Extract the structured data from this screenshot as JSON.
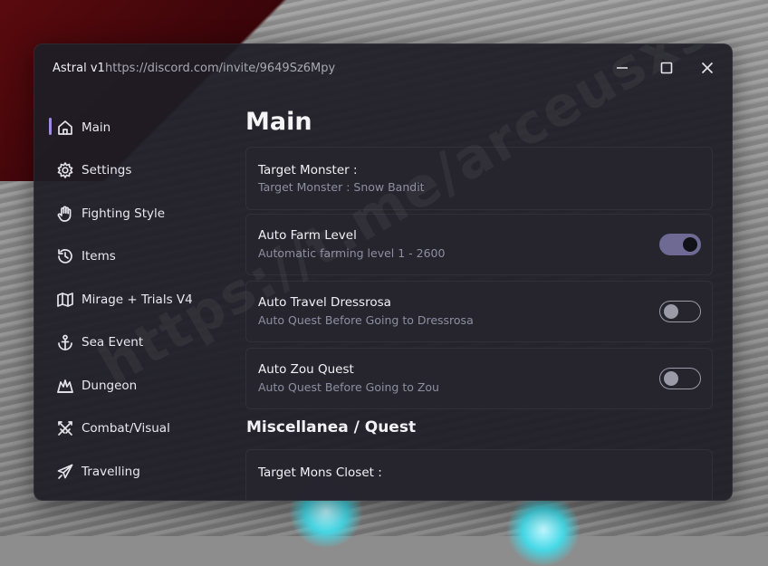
{
  "window": {
    "app_name": "Astral v1",
    "link": "https://discord.com/invite/9649Sz6Mpy"
  },
  "controls": {
    "minimize_icon": "minimize-icon",
    "maximize_icon": "maximize-icon",
    "close_icon": "close-icon"
  },
  "sidebar": {
    "items": [
      {
        "label": "Main",
        "icon": "home-icon",
        "active": true
      },
      {
        "label": "Settings",
        "icon": "gear-icon"
      },
      {
        "label": "Fighting Style",
        "icon": "hand-icon"
      },
      {
        "label": "Items",
        "icon": "history-icon"
      },
      {
        "label": "Mirage + Trials V4",
        "icon": "map-icon"
      },
      {
        "label": "Sea Event",
        "icon": "anchor-icon"
      },
      {
        "label": "Dungeon",
        "icon": "castle-icon"
      },
      {
        "label": "Combat/Visual",
        "icon": "swords-icon"
      },
      {
        "label": "Travelling",
        "icon": "plane-icon"
      }
    ]
  },
  "main": {
    "title": "Main",
    "target_monster": {
      "title": "Target Monster :",
      "subtitle": "Target Monster : Snow Bandit"
    },
    "toggles": [
      {
        "title": "Auto Farm Level",
        "subtitle": "Automatic farming level 1 - 2600",
        "enabled": true
      },
      {
        "title": "Auto Travel Dressrosa",
        "subtitle": "Auto Quest Before Going to Dressrosa",
        "enabled": false
      },
      {
        "title": "Auto Zou Quest",
        "subtitle": "Auto Quest Before Going to Zou",
        "enabled": false
      }
    ],
    "section_misc": "Miscellanea / Quest",
    "target_closet": {
      "title": "Target Mons Closet :"
    }
  },
  "overlay": {
    "watermark": "https://t.me/arceusxscripts"
  },
  "colors": {
    "window_bg": "#1e1d26",
    "accent": "#a08be0",
    "toggle_on": "#6f6a94"
  }
}
